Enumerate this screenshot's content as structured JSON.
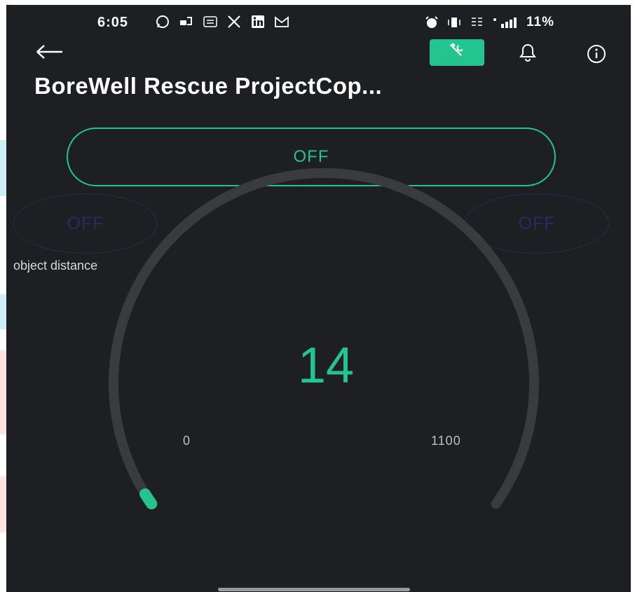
{
  "status_bar": {
    "time": "6:05",
    "battery": "11%",
    "left_icons": [
      "whatsapp-icon",
      "cast-icon",
      "message-icon",
      "x-icon",
      "linkedin-icon",
      "gmail-icon"
    ],
    "right_icons": [
      "alarm-icon",
      "vibrate-icon",
      "volte-icon",
      "signal-icon"
    ]
  },
  "toolbar": {
    "back_icon": "arrow-left-icon",
    "wrench_icon": "wrench-icon",
    "bell_icon": "bell-icon",
    "info_icon": "info-icon"
  },
  "title": "BoreWell Rescue ProjectCop...",
  "widgets": {
    "main_button": {
      "label": "OFF"
    },
    "left_button": {
      "label": "OFF"
    },
    "right_button": {
      "label": "OFF"
    },
    "gauge": {
      "label": "object distance",
      "value": "14",
      "min": "0",
      "max": "1100",
      "fraction": 0.0127
    }
  },
  "colors": {
    "accent": "#23c48e",
    "background": "#1e1f22",
    "inactive": "#2b2a66",
    "track": "#3a3b3e"
  }
}
